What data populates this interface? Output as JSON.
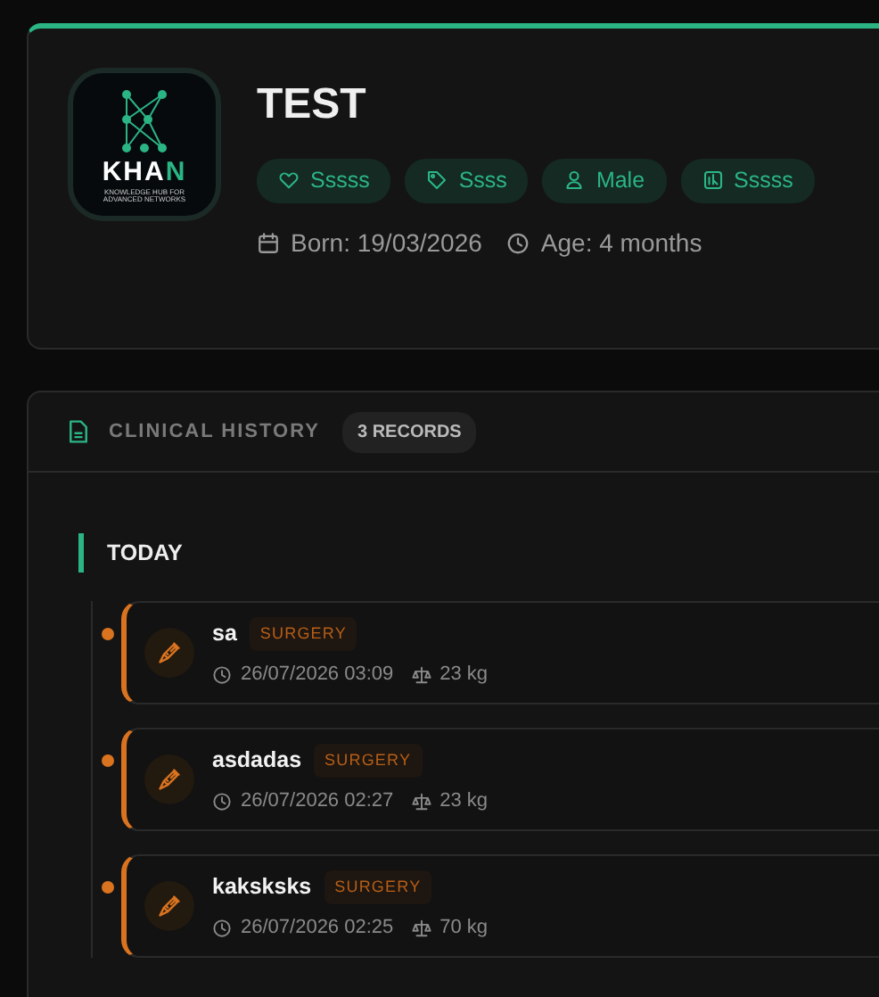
{
  "profile": {
    "logo": {
      "word_main": "KHA",
      "word_accent": "N",
      "tagline": "KNOWLEDGE HUB FOR ADVANCED NETWORKS"
    },
    "name": "TEST",
    "tags": [
      {
        "kind": "heart",
        "label": "Sssss"
      },
      {
        "kind": "tag",
        "label": "Ssss"
      },
      {
        "kind": "person",
        "label": "Male"
      },
      {
        "kind": "chart",
        "label": "Sssss"
      }
    ],
    "born": "Born: 19/03/2026",
    "age": "Age: 4 months"
  },
  "history": {
    "title": "CLINICAL HISTORY",
    "count": "3 RECORDS",
    "groups": [
      {
        "label": "TODAY",
        "records": [
          {
            "title": "sa",
            "type": "SURGERY",
            "datetime": "26/07/2026 03:09",
            "weight": "23 kg"
          },
          {
            "title": "asdadas",
            "type": "SURGERY",
            "datetime": "26/07/2026 02:27",
            "weight": "23 kg"
          },
          {
            "title": "kaksksks",
            "type": "SURGERY",
            "datetime": "26/07/2026 02:25",
            "weight": "70 kg"
          }
        ]
      }
    ]
  }
}
